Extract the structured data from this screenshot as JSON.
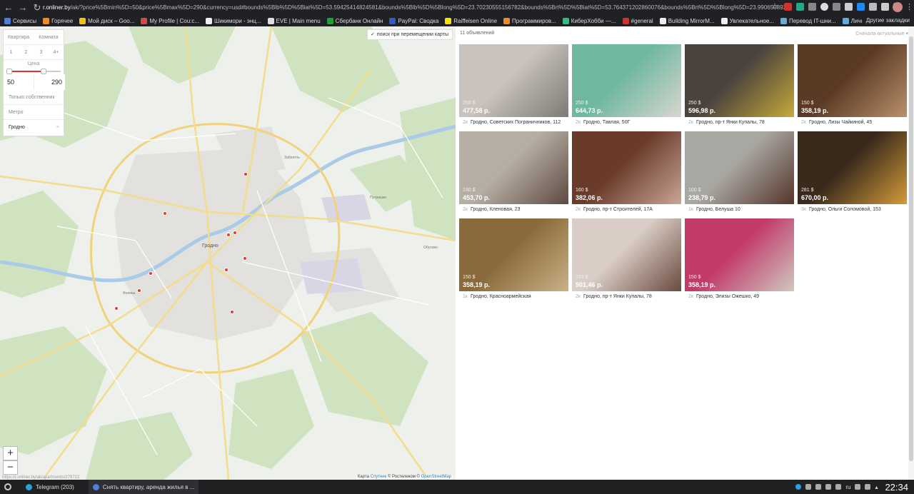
{
  "browser": {
    "url_host": "r.onliner.by",
    "url_rest": "/ak/?price%5Bmin%5D=50&price%5Bmax%5D=290&currency=usd#bounds%5Blb%5D%5Blat%5D=53.59425414824581&bounds%5Blb%5D%5Blong%5D=23.70230555156782&bounds%5Brt%5D%5Blat%5D=53.764371202860076&bounds%5Brt%5D%5Blong%5D=23.990650893269457"
  },
  "bookmarks": [
    {
      "label": "Сервисы",
      "color": "#4f7fd8"
    },
    {
      "label": "Горячее",
      "color": "#f08a24"
    },
    {
      "label": "Мой диск – Goo...",
      "color": "#f4c20d"
    },
    {
      "label": "My Profile | Cou:c...",
      "color": "#d44"
    },
    {
      "label": "Шикимори - энц...",
      "color": "#eee"
    },
    {
      "label": "EVE | Main menu",
      "color": "#ddd"
    },
    {
      "label": "Сбербанк Онлайн",
      "color": "#21a038"
    },
    {
      "label": "PayPal: Сводка",
      "color": "#2a5ec8"
    },
    {
      "label": "Raiffeisen Online",
      "color": "#f5e000"
    },
    {
      "label": "Программиров...",
      "color": "#f08a24"
    },
    {
      "label": "КиберХобби —...",
      "color": "#3b8"
    },
    {
      "label": "#general",
      "color": "#c33"
    },
    {
      "label": "Building MirrorM...",
      "color": "#eee"
    },
    {
      "label": "Увлекательное...",
      "color": "#eee"
    },
    {
      "label": "Перевод IT-шни...",
      "color": "#6ad"
    },
    {
      "label": "Личный опыт п...",
      "color": "#6ad"
    }
  ],
  "other_bookmarks": "Другие закладки",
  "filter": {
    "type_tabs": [
      "Квартира",
      "Комната"
    ],
    "rooms": [
      "1",
      "2",
      "3",
      "4+"
    ],
    "price_label": "Цена",
    "price_min": "50",
    "price_max": "290",
    "owner_only": "Только собственник",
    "metro": "Метро",
    "city": "Гродно",
    "clear": "×"
  },
  "map": {
    "search_on_move": "поиск при перемещении карты",
    "zoom_in": "+",
    "zoom_out": "−",
    "attribution_prefix": "Карта",
    "attribution_sputnik": "Спутник",
    "attribution_mid": "© Ростелеком ©",
    "attribution_osm": "OpenStreetMap",
    "status_url": "https://r.onliner.by/ak/apartments/279722",
    "labels": {
      "grodno": "Гродно",
      "folwarki": "Фолюш",
      "zapolye": "Заболоть",
      "putrishki": "Путришки",
      "obukhovo": "Обухово"
    }
  },
  "listings": {
    "count_label": "11 объявлений",
    "sort_label": "Сначала актуальные",
    "items": [
      {
        "usd": "250 $",
        "byn": "477,58 р.",
        "rooms": "2к",
        "address": "Гродно, Советских Пограничников, 112",
        "c1": "#c9c2bd",
        "c2": "#7e7a73"
      },
      {
        "usd": "250 $",
        "byn": "644,73 р.",
        "rooms": "2к",
        "address": "Гродно, Тавлая, 50Г",
        "c1": "#6fb7a0",
        "c2": "#d9d6cf"
      },
      {
        "usd": "250 $",
        "byn": "596,98 р.",
        "rooms": "2к",
        "address": "Гродно, пр-т Янки Купалы, 78",
        "c1": "#4a423d",
        "c2": "#c7a93c"
      },
      {
        "usd": "150 $",
        "byn": "358,19 р.",
        "rooms": "2к",
        "address": "Гродно, Лизы Чайкиной, 45",
        "c1": "#5b3a25",
        "c2": "#b9906a"
      },
      {
        "usd": "190 $",
        "byn": "453,70 р.",
        "rooms": "2к",
        "address": "Гродно, Кленовая, 23",
        "c1": "#b7aea3",
        "c2": "#5e4a42"
      },
      {
        "usd": "160 $",
        "byn": "382,06 р.",
        "rooms": "2к",
        "address": "Гродно, пр-т Строителей, 17А",
        "c1": "#6a3b2b",
        "c2": "#caa595"
      },
      {
        "usd": "100 $",
        "byn": "238,79 р.",
        "rooms": "1к",
        "address": "Гродно, Белуша 10",
        "c1": "#a9a7a2",
        "c2": "#54352a"
      },
      {
        "usd": "281 $",
        "byn": "670,00 р.",
        "rooms": "3к",
        "address": "Гродно, Ольги Соломовой, 153",
        "c1": "#3a2a1c",
        "c2": "#d49a3a"
      },
      {
        "usd": "150 $",
        "byn": "358,19 р.",
        "rooms": "1к",
        "address": "Гродно, Красноармейская",
        "c1": "#8a6a3c",
        "c2": "#c9b086"
      },
      {
        "usd": "210 $",
        "byn": "501,46 р.",
        "rooms": "2к",
        "address": "Гродно, пр-т Янки Купалы, 78",
        "c1": "#d9cdc5",
        "c2": "#6a4a3f"
      },
      {
        "usd": "150 $",
        "byn": "358,19 р.",
        "rooms": "2к",
        "address": "Гродно, Элизы Ожешко, 49",
        "c1": "#c23a6a",
        "c2": "#cfc8c0"
      }
    ]
  },
  "taskbar": {
    "items": [
      {
        "label": "Telegram (203)",
        "color": "#2aa1da"
      },
      {
        "label": "Снять квартиру, аренда жилья в ...",
        "color": "#4f7fd8"
      }
    ],
    "lang": "ru",
    "clock": "22:34"
  }
}
